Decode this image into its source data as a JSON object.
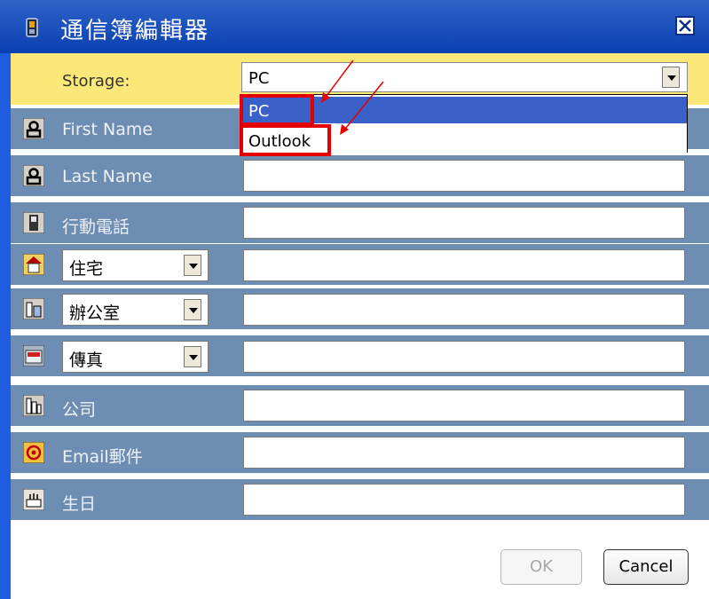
{
  "window": {
    "title": "通信簿編輯器"
  },
  "storage": {
    "label": "Storage:",
    "value": "PC",
    "options": [
      "PC",
      "Outlook"
    ]
  },
  "fields": [
    {
      "label": "First Name",
      "icon": "person-icon",
      "value": ""
    },
    {
      "label": "Last Name",
      "icon": "person-icon",
      "value": ""
    },
    {
      "label": "行動電話",
      "icon": "mobile-phone-icon",
      "value": ""
    },
    {
      "select": "住宅",
      "icon": "home-icon",
      "value": ""
    },
    {
      "select": "辦公室",
      "icon": "office-icon",
      "value": ""
    },
    {
      "select": "傳真",
      "icon": "fax-icon",
      "value": ""
    },
    {
      "label": "公司",
      "icon": "company-icon",
      "value": ""
    },
    {
      "label": "Email郵件",
      "icon": "email-icon",
      "value": ""
    },
    {
      "label": "生日",
      "icon": "birthday-cake-icon",
      "value": ""
    }
  ],
  "buttons": {
    "ok": "OK",
    "cancel": "Cancel"
  },
  "colors": {
    "titlebar": "#0a3fb0",
    "storage_bg": "#fce879",
    "row_bg": "#6d8db3",
    "highlight": "#3a61c8",
    "annotation": "#e40000"
  }
}
